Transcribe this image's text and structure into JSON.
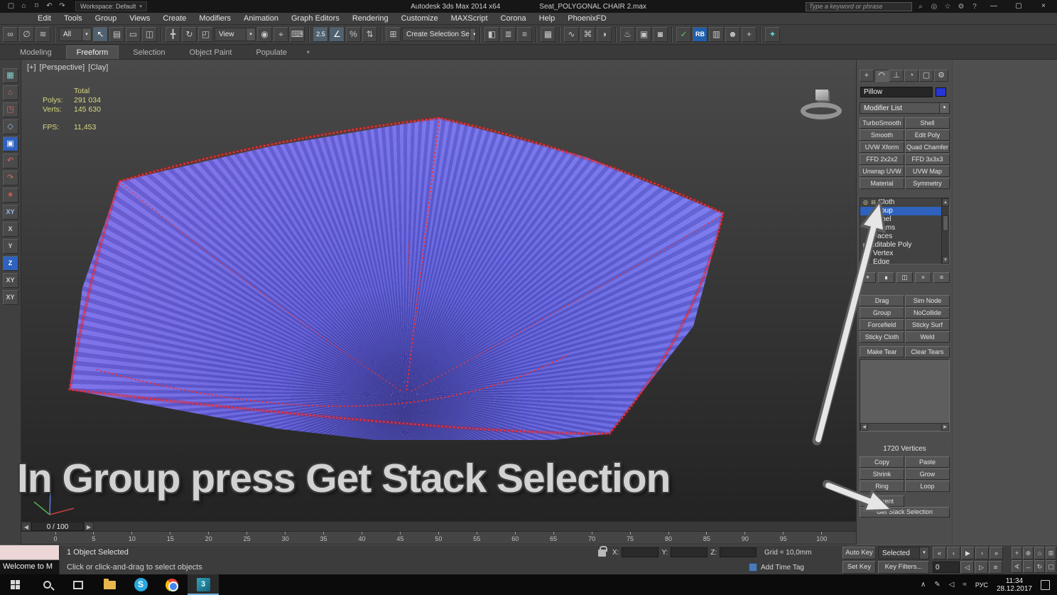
{
  "ui": {
    "chev": "▾",
    "up": "▲",
    "down": "▼",
    "left": "◀",
    "right": "▶",
    "min": "—",
    "max": "▢",
    "close": "×"
  },
  "colors": {
    "selection_blue": "#2e62be",
    "cloth_blue": "#6a6ae0",
    "cloth_edge_red": "#ff2d2d",
    "stat_yellow": "#d9d87f",
    "panel_gray": "#4d4d4d"
  },
  "title_bar": {
    "app_title": "Autodesk 3ds Max 2014 x64",
    "file_name": "Seat_POLYGONAL CHAIR 2.max",
    "search_placeholder": "Type a keyword or phrase",
    "workspace_label": "Workspace: Default",
    "qat": [
      "▢",
      "⌂",
      "⌑",
      "↶",
      "↷"
    ],
    "right_icons": [
      "⌕",
      "◎",
      "☆",
      "⚙",
      "?"
    ]
  },
  "menu_bar": {
    "items": [
      "Edit",
      "Tools",
      "Group",
      "Views",
      "Create",
      "Modifiers",
      "Animation",
      "Graph Editors",
      "Rendering",
      "Customize",
      "MAXScript",
      "Corona",
      "Help",
      "PhoenixFD"
    ]
  },
  "toolbar": {
    "icons": [
      {
        "g": "∞"
      },
      {
        "g": "∅"
      },
      {
        "g": "≋"
      },
      {
        "g": "All"
      },
      {
        "g": "↖"
      },
      {
        "g": "▤"
      },
      {
        "g": "▭"
      },
      {
        "g": "◫"
      },
      {
        "g": "╋"
      },
      {
        "g": "↻"
      },
      {
        "g": "◰"
      },
      {
        "g": "View"
      },
      {
        "g": "◉"
      },
      {
        "g": "⌖"
      },
      {
        "g": "⌨"
      },
      {
        "g": "2.5"
      },
      {
        "g": "∠"
      },
      {
        "g": "%"
      },
      {
        "g": "⇅"
      },
      {
        "g": "⊞"
      },
      {
        "g": "Create Selection Se"
      },
      {
        "g": "◧"
      },
      {
        "g": "≣"
      },
      {
        "g": "≡"
      },
      {
        "g": "▦"
      },
      {
        "g": "∿"
      },
      {
        "g": "⌘"
      },
      {
        "g": "◑"
      },
      {
        "g": "♨"
      },
      {
        "g": "▣"
      },
      {
        "g": "◙"
      },
      {
        "g": "✓"
      },
      {
        "g": "RB"
      },
      {
        "g": "▥"
      },
      {
        "g": "☻"
      },
      {
        "g": "+"
      },
      {
        "g": "✦"
      }
    ]
  },
  "ribbon": {
    "tabs": [
      "Modeling",
      "Freeform",
      "Selection",
      "Object Paint",
      "Populate"
    ]
  },
  "left_toolbar": {
    "glyphs": [
      "▦",
      "⌂",
      "◳",
      "◇",
      "▣",
      "↶",
      "↷",
      "∗",
      "XY",
      "X",
      "Y",
      "Z",
      "XY",
      "XY"
    ]
  },
  "viewport": {
    "label_parts": [
      "[+]",
      "[Perspective]",
      "[Clay]"
    ],
    "stats": {
      "total": "Total",
      "polys_label": "Polys:",
      "polys": "291 034",
      "verts_label": "Verts:",
      "verts": "145 630",
      "fps_label": "FPS:",
      "fps": "11,453"
    },
    "overlay_text": "In Group press Get Stack Selection"
  },
  "command_panel": {
    "tab_glyphs": [
      "+",
      "◠",
      "⊥",
      "◔",
      "▢",
      "⚙"
    ],
    "object_name": "Pillow",
    "modifier_list_label": "Modifier List",
    "modifier_buttons": [
      "TurboSmooth",
      "Shell",
      "Smooth",
      "Edit Poly",
      "UVW Xform",
      "Quad Chamfer",
      "FFD 2x2x2",
      "FFD 3x3x3",
      "Unwrap UVW",
      "UVW Map",
      "Material",
      "Symmetry"
    ],
    "stack_icon_bulb": "◎",
    "stack_icon_collapse": "⊟",
    "stack_icon_mesh": "▤",
    "stack_items": {
      "cloth": "Cloth",
      "group": "Group",
      "panel": "Panel",
      "seams": "Seams",
      "faces": "Faces",
      "editable_poly": "Editable Poly",
      "vertex": "Vertex",
      "edge": "Edge"
    },
    "stack_tools": [
      "⌖",
      "∎",
      "◫",
      "×",
      "≡"
    ],
    "group_buttons": [
      "Drag",
      "Sim Node",
      "Group",
      "NoCollide",
      "Forcefield",
      "Sticky Surf",
      "Sticky Cloth",
      "Weld"
    ],
    "tear_buttons": [
      "Make Tear",
      "Clear Tears"
    ],
    "vertices_label": "1720 Vertices",
    "sel_buttons": [
      "Copy",
      "Paste",
      "Shrink",
      "Grow",
      "Ring",
      "Loop"
    ],
    "element_button": "Element",
    "get_stack_selection": "Get Stack Selection"
  },
  "timeline": {
    "frame_indicator": "0 / 100",
    "ticks": [
      "0",
      "5",
      "10",
      "15",
      "20",
      "25",
      "30",
      "35",
      "40",
      "45",
      "50",
      "55",
      "60",
      "65",
      "70",
      "75",
      "80",
      "85",
      "90",
      "95",
      "100"
    ]
  },
  "status_bar": {
    "object_selected": "1 Object Selected",
    "prompt": "Click or click-and-drag to select objects",
    "listener_text": "Welcome to M",
    "x_label": "X:",
    "y_label": "Y:",
    "z_label": "Z:",
    "grid_label": "Grid = 10,0mm",
    "add_time_tag": "Add Time Tag",
    "auto_key": "Auto Key",
    "set_key": "Set Key",
    "selected_mode": "Selected",
    "key_filters": "Key Filters...",
    "frame_value": "0",
    "playback": [
      "«",
      "‹",
      "▶",
      "›",
      "»"
    ],
    "row2_btns": [
      "◁",
      "▷",
      "≡"
    ],
    "nav": [
      "+",
      "⊕",
      "⌂",
      "⊞",
      "∢",
      "↔",
      "↻",
      "▢"
    ]
  },
  "taskbar": {
    "skype_letter": "S",
    "max_glyph": "3",
    "language": "РУС",
    "time": "11:34",
    "date": "28.12.2017"
  }
}
